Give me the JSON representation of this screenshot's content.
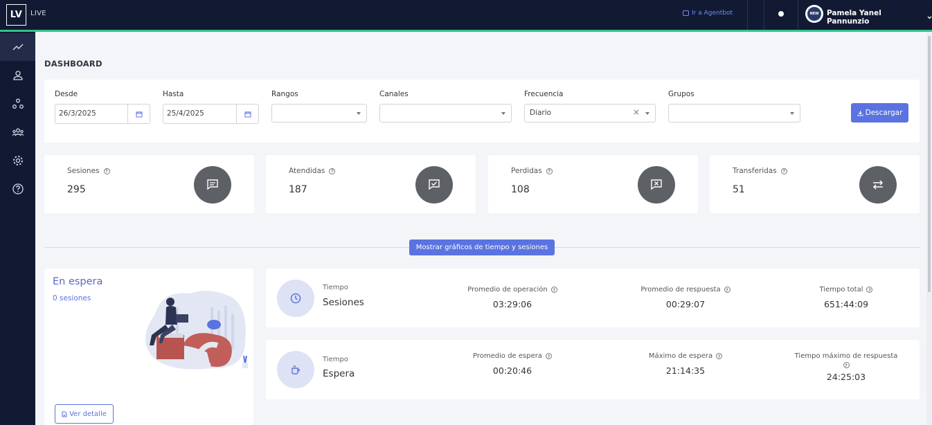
{
  "app": {
    "logo": "LV",
    "name": "LIVE"
  },
  "topbar": {
    "agentbot_link": "Ir a Agentbot",
    "user_name": "Pamela Yanel Pannunzio",
    "avatar_text": "NEW"
  },
  "sidebar": {
    "items": [
      "dashboard-chart",
      "user",
      "network",
      "team",
      "settings",
      "help"
    ]
  },
  "page": {
    "title": "DASHBOARD"
  },
  "filters": {
    "desde_label": "Desde",
    "desde_value": "26/3/2025",
    "hasta_label": "Hasta",
    "hasta_value": "25/4/2025",
    "rangos_label": "Rangos",
    "rangos_value": "",
    "canales_label": "Canales",
    "canales_value": "",
    "frecuencia_label": "Frecuencia",
    "frecuencia_value": "Diario",
    "grupos_label": "Grupos",
    "grupos_value": "",
    "download_label": "Descargar"
  },
  "stats": [
    {
      "label": "Sesiones",
      "value": "295"
    },
    {
      "label": "Atendidas",
      "value": "187"
    },
    {
      "label": "Perdidas",
      "value": "108"
    },
    {
      "label": "Transferidas",
      "value": "51"
    }
  ],
  "show_charts_button": "Mostrar gráficos de tiempo y sesiones",
  "waiting": {
    "title": "En espera",
    "subtitle": "0 sesiones",
    "detail_button": "Ver detalle"
  },
  "time_sessions": {
    "small": "Tiempo",
    "big": "Sesiones",
    "metrics": [
      {
        "label": "Promedio de operación",
        "value": "03:29:06"
      },
      {
        "label": "Promedio de respuesta",
        "value": "00:29:07"
      },
      {
        "label": "Tiempo total",
        "value": "651:44:09"
      }
    ]
  },
  "time_wait": {
    "small": "Tiempo",
    "big": "Espera",
    "metrics": [
      {
        "label": "Promedio de espera",
        "value": "00:20:46"
      },
      {
        "label": "Máximo de espera",
        "value": "21:14:35"
      },
      {
        "label": "Tiempo máximo de respuesta",
        "value": "24:25:03"
      }
    ]
  },
  "colors": {
    "primary": "#5a73e0",
    "navbar": "#121a33",
    "accent_line": "#2ec58a",
    "stat_circle": "#5d6065"
  }
}
